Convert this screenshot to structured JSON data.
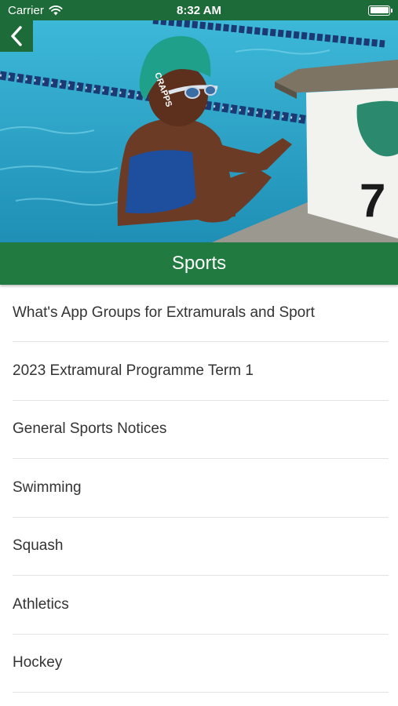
{
  "status_bar": {
    "carrier": "Carrier",
    "time": "8:32 AM",
    "battery_level": 1.0
  },
  "header": {
    "back_icon": "chevron-left-icon",
    "hero_image": "swimmer at pool lane start block",
    "start_block_number": "7",
    "cap_text": "CRAPPS",
    "title": "Sports"
  },
  "menu": {
    "items": [
      {
        "label": "What's App Groups for Extramurals and Sport"
      },
      {
        "label": "2023 Extramural Programme Term 1"
      },
      {
        "label": "General Sports Notices"
      },
      {
        "label": "Swimming"
      },
      {
        "label": "Squash"
      },
      {
        "label": "Athletics"
      },
      {
        "label": "Hockey"
      }
    ]
  },
  "colors": {
    "brand_green": "#217a3f",
    "status_green": "#1d6b38",
    "text": "#333333",
    "divider": "#e4e4e4"
  }
}
